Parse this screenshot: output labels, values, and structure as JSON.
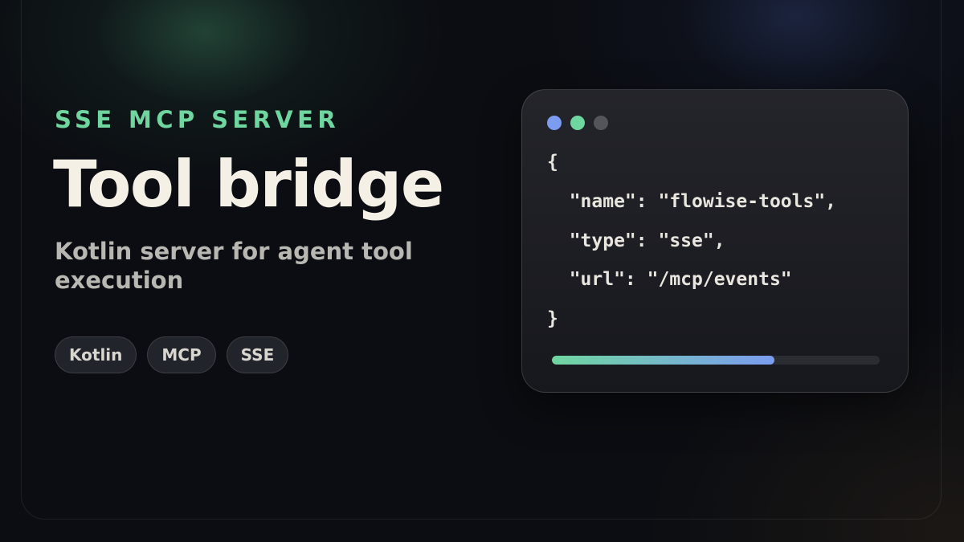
{
  "hero": {
    "eyebrow": "SSE MCP SERVER",
    "title": "Tool bridge",
    "subtitle": "Kotlin server for agent tool execution",
    "tags": [
      "Kotlin",
      "MCP",
      "SSE"
    ]
  },
  "code_card": {
    "window_dots": [
      "blue",
      "green",
      "grey"
    ],
    "lines": [
      "{",
      "  \"name\": \"flowise-tools\",",
      "  \"type\": \"sse\",",
      "  \"url\": \"/mcp/events\"",
      "}"
    ],
    "progress_fraction": 0.68
  },
  "colors": {
    "accent_green": "#6fd6a0",
    "accent_blue": "#7b9cf0",
    "title": "#f5f0e6",
    "background": "#0b0d12"
  }
}
